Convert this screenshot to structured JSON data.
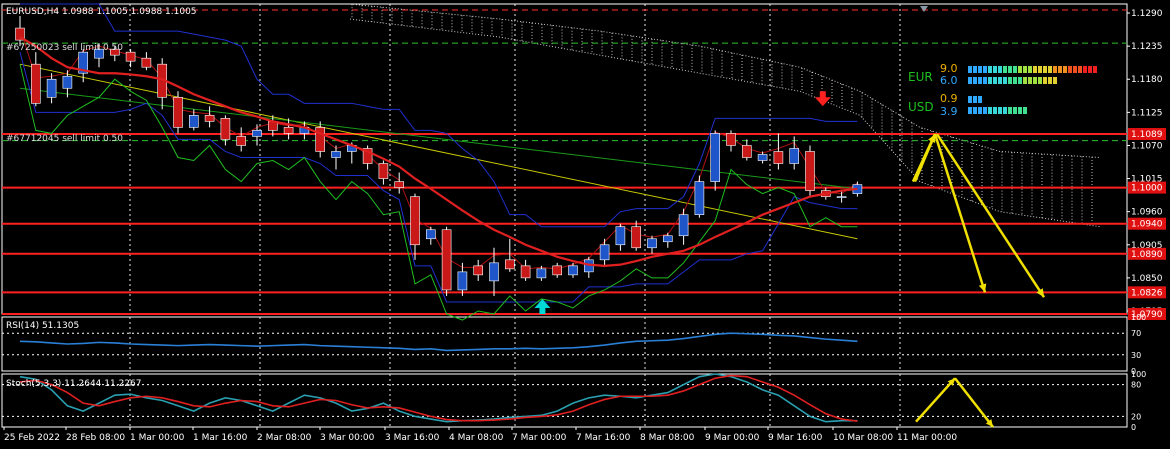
{
  "header": {
    "title": "EURUSD,H4  1.0988 1.1005 1.0988 1.1005",
    "order1": "#67250023 sell limit 0.50",
    "order2": "#67712045 sell limit 0.50"
  },
  "colors": {
    "bg": "#000000",
    "bull": "#1e55c8",
    "bear": "#c81818",
    "grid": "#ffffff",
    "level": "#ff2020",
    "arrow": "#f0e000",
    "ma_fast": "#e02020",
    "ma_slow": "#c8c800",
    "ma_green": "#1a9a1a",
    "envelope": "#2030d0",
    "rsi": "#2a7fd6",
    "stoch_main": "#2a9fb0",
    "stoch_signal": "#e02020"
  },
  "chart_data": [
    {
      "type": "candlestick",
      "symbol": "EURUSD",
      "timeframe": "H4",
      "ylim": [
        1.079,
        1.1305
      ],
      "y_ticks": [
        "1.1290",
        "1.1235",
        "1.1180",
        "1.1125",
        "1.1070",
        "1.1015",
        "1.0960",
        "1.0905",
        "1.0850",
        "1.0795"
      ],
      "price_labels": [
        {
          "text": "1.1089",
          "value": 1.1089
        },
        {
          "text": "1.1000",
          "value": 1.1
        },
        {
          "text": "1.0940",
          "value": 1.094
        },
        {
          "text": "1.0890",
          "value": 1.089
        },
        {
          "text": "1.0826",
          "value": 1.0826
        },
        {
          "text": "1.0790",
          "value": 1.079
        }
      ],
      "levels": [
        1.1089,
        1.1,
        1.094,
        1.089,
        1.0826,
        1.079
      ],
      "dashed_levels": [
        1.1295,
        1.124,
        1.1078
      ],
      "x_labels": [
        "25 Feb 2022",
        "28 Feb 08:00",
        "1 Mar 00:00",
        "1 Mar 16:00",
        "2 Mar 08:00",
        "3 Mar 00:00",
        "3 Mar 16:00",
        "4 Mar 08:00",
        "7 Mar 00:00",
        "7 Mar 16:00",
        "8 Mar 08:00",
        "9 Mar 00:00",
        "9 Mar 16:00",
        "10 Mar 08:00",
        "11 Mar 00:00"
      ],
      "candles": [
        [
          1.1265,
          1.1285,
          1.1235,
          1.1245
        ],
        [
          1.1205,
          1.1225,
          1.1135,
          1.114
        ],
        [
          1.115,
          1.119,
          1.114,
          1.118
        ],
        [
          1.1165,
          1.1195,
          1.115,
          1.1185
        ],
        [
          1.119,
          1.123,
          1.1175,
          1.1225
        ],
        [
          1.1215,
          1.124,
          1.12,
          1.123
        ],
        [
          1.123,
          1.1235,
          1.121,
          1.122
        ],
        [
          1.1225,
          1.123,
          1.12,
          1.121
        ],
        [
          1.1215,
          1.1225,
          1.1195,
          1.12
        ],
        [
          1.1205,
          1.1215,
          1.113,
          1.115
        ],
        [
          1.115,
          1.116,
          1.109,
          1.11
        ],
        [
          1.11,
          1.113,
          1.1095,
          1.112
        ],
        [
          1.112,
          1.1135,
          1.11,
          1.111
        ],
        [
          1.1115,
          1.112,
          1.107,
          1.108
        ],
        [
          1.1085,
          1.11,
          1.106,
          1.107
        ],
        [
          1.1085,
          1.1105,
          1.107,
          1.1095
        ],
        [
          1.111,
          1.112,
          1.1085,
          1.1095
        ],
        [
          1.11,
          1.1115,
          1.108,
          1.109
        ],
        [
          1.109,
          1.111,
          1.108,
          1.11
        ],
        [
          1.11,
          1.111,
          1.105,
          1.106
        ],
        [
          1.105,
          1.107,
          1.103,
          1.106
        ],
        [
          1.106,
          1.1075,
          1.104,
          1.107
        ],
        [
          1.1065,
          1.107,
          1.103,
          1.104
        ],
        [
          1.104,
          1.1045,
          1.1005,
          1.1015
        ],
        [
          1.101,
          1.1025,
          1.099,
          1.1
        ],
        [
          1.0985,
          1.099,
          1.088,
          1.0905
        ],
        [
          1.0915,
          1.0935,
          1.0905,
          1.093
        ],
        [
          1.093,
          1.0935,
          1.082,
          1.083
        ],
        [
          1.083,
          1.0875,
          1.082,
          1.086
        ],
        [
          1.087,
          1.088,
          1.0845,
          1.0855
        ],
        [
          1.0845,
          1.09,
          1.082,
          1.0875
        ],
        [
          1.088,
          1.0915,
          1.086,
          1.0865
        ],
        [
          1.087,
          1.088,
          1.0845,
          1.085
        ],
        [
          1.085,
          1.087,
          1.0845,
          1.0865
        ],
        [
          1.087,
          1.0875,
          1.085,
          1.0855
        ],
        [
          1.0855,
          1.0875,
          1.085,
          1.087
        ],
        [
          1.086,
          1.0885,
          1.085,
          1.088
        ],
        [
          1.088,
          1.0915,
          1.087,
          1.0905
        ],
        [
          1.0905,
          1.094,
          1.0895,
          1.0935
        ],
        [
          1.0935,
          1.0945,
          1.0895,
          1.09
        ],
        [
          1.09,
          1.092,
          1.089,
          1.0915
        ],
        [
          1.091,
          1.0925,
          1.09,
          1.092
        ],
        [
          1.092,
          1.0965,
          1.0905,
          1.0955
        ],
        [
          1.0955,
          1.102,
          1.095,
          1.101
        ],
        [
          1.101,
          1.1095,
          1.0995,
          1.109
        ],
        [
          1.109,
          1.1095,
          1.106,
          1.107
        ],
        [
          1.107,
          1.108,
          1.1045,
          1.105
        ],
        [
          1.1045,
          1.106,
          1.104,
          1.1055
        ],
        [
          1.106,
          1.109,
          1.103,
          1.104
        ],
        [
          1.104,
          1.1085,
          1.103,
          1.1065
        ],
        [
          1.106,
          1.107,
          1.0985,
          1.0995
        ],
        [
          1.0995,
          1.1,
          1.098,
          1.0985
        ],
        [
          1.0985,
          1.0995,
          1.0975,
          1.0985
        ],
        [
          1.099,
          1.101,
          1.0985,
          1.1005
        ]
      ],
      "ma_fast": [
        1.125,
        1.1235,
        1.1215,
        1.12,
        1.1195,
        1.119,
        1.119,
        1.1188,
        1.1185,
        1.118,
        1.1168,
        1.1155,
        1.1145,
        1.1135,
        1.1125,
        1.1118,
        1.111,
        1.1105,
        1.11,
        1.109,
        1.108,
        1.107,
        1.106,
        1.1048,
        1.1035,
        1.1015,
        1.0998,
        1.098,
        1.0962,
        1.0945,
        1.093,
        1.0918,
        1.0905,
        1.0895,
        1.0885,
        1.0878,
        1.0872,
        1.087,
        1.0872,
        1.0878,
        1.0885,
        1.089,
        1.0895,
        1.0905,
        1.0918,
        1.093,
        1.0942,
        1.0955,
        1.0965,
        1.0975,
        1.0985,
        1.099,
        1.0995,
        1.0998
      ],
      "ma_slow_start_end": [
        1.1205,
        1.0915
      ],
      "ma_green_start_end": [
        1.1165,
        1.0998
      ],
      "stop_arrow_label": "sell signal",
      "buy_arrow_label": "buy signal",
      "eur_label": "EUR",
      "eur_values": [
        "9.0",
        "6.0"
      ],
      "usd_label": "USD",
      "usd_values": [
        "0.9",
        "3.9"
      ]
    },
    {
      "type": "line",
      "title": "RSI(14) 51.1305",
      "ylim": [
        0,
        100
      ],
      "y_ticks": [
        "100",
        "70",
        "30",
        "0"
      ],
      "values": [
        55,
        54,
        52,
        50,
        51,
        53,
        52,
        50,
        49,
        48,
        47,
        48,
        49,
        48,
        47,
        46,
        47,
        48,
        49,
        47,
        46,
        45,
        44,
        43,
        42,
        40,
        41,
        38,
        39,
        40,
        41,
        41,
        42,
        41,
        42,
        43,
        45,
        48,
        52,
        55,
        56,
        57,
        60,
        64,
        68,
        70,
        69,
        68,
        66,
        65,
        62,
        59,
        57,
        55
      ]
    },
    {
      "type": "line",
      "title": "Stoch(5,3,3) 11.2644 11.2267",
      "ylim": [
        0,
        100
      ],
      "y_ticks": [
        "100",
        "80",
        "20",
        "0"
      ],
      "main": [
        95,
        90,
        70,
        40,
        30,
        45,
        60,
        62,
        55,
        50,
        40,
        30,
        45,
        55,
        50,
        40,
        30,
        45,
        60,
        55,
        45,
        30,
        35,
        45,
        30,
        20,
        15,
        10,
        12,
        13,
        15,
        18,
        20,
        22,
        30,
        45,
        55,
        60,
        58,
        55,
        60,
        65,
        80,
        95,
        100,
        95,
        85,
        70,
        60,
        40,
        20,
        10,
        12,
        12
      ],
      "signal": [
        85,
        88,
        80,
        65,
        45,
        40,
        48,
        55,
        58,
        55,
        48,
        40,
        38,
        45,
        50,
        48,
        40,
        38,
        45,
        52,
        50,
        42,
        36,
        38,
        36,
        28,
        20,
        14,
        12,
        12,
        13,
        15,
        18,
        20,
        23,
        30,
        42,
        52,
        58,
        58,
        58,
        60,
        68,
        80,
        92,
        97,
        95,
        85,
        75,
        60,
        42,
        25,
        15,
        11
      ]
    }
  ]
}
